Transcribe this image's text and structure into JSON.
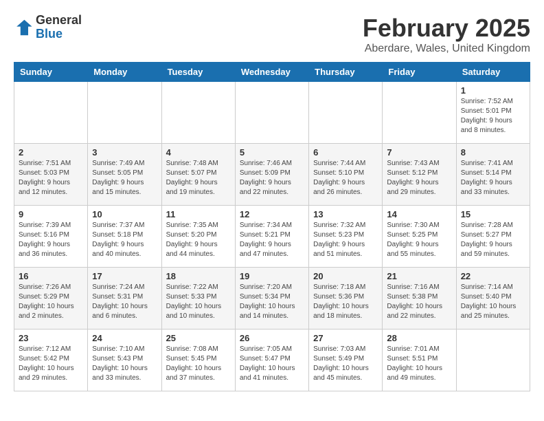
{
  "header": {
    "logo_general": "General",
    "logo_blue": "Blue",
    "title": "February 2025",
    "subtitle": "Aberdare, Wales, United Kingdom"
  },
  "columns": [
    "Sunday",
    "Monday",
    "Tuesday",
    "Wednesday",
    "Thursday",
    "Friday",
    "Saturday"
  ],
  "weeks": [
    [
      {
        "day": "",
        "info": ""
      },
      {
        "day": "",
        "info": ""
      },
      {
        "day": "",
        "info": ""
      },
      {
        "day": "",
        "info": ""
      },
      {
        "day": "",
        "info": ""
      },
      {
        "day": "",
        "info": ""
      },
      {
        "day": "1",
        "info": "Sunrise: 7:52 AM\nSunset: 5:01 PM\nDaylight: 9 hours and 8 minutes."
      }
    ],
    [
      {
        "day": "2",
        "info": "Sunrise: 7:51 AM\nSunset: 5:03 PM\nDaylight: 9 hours and 12 minutes."
      },
      {
        "day": "3",
        "info": "Sunrise: 7:49 AM\nSunset: 5:05 PM\nDaylight: 9 hours and 15 minutes."
      },
      {
        "day": "4",
        "info": "Sunrise: 7:48 AM\nSunset: 5:07 PM\nDaylight: 9 hours and 19 minutes."
      },
      {
        "day": "5",
        "info": "Sunrise: 7:46 AM\nSunset: 5:09 PM\nDaylight: 9 hours and 22 minutes."
      },
      {
        "day": "6",
        "info": "Sunrise: 7:44 AM\nSunset: 5:10 PM\nDaylight: 9 hours and 26 minutes."
      },
      {
        "day": "7",
        "info": "Sunrise: 7:43 AM\nSunset: 5:12 PM\nDaylight: 9 hours and 29 minutes."
      },
      {
        "day": "8",
        "info": "Sunrise: 7:41 AM\nSunset: 5:14 PM\nDaylight: 9 hours and 33 minutes."
      }
    ],
    [
      {
        "day": "9",
        "info": "Sunrise: 7:39 AM\nSunset: 5:16 PM\nDaylight: 9 hours and 36 minutes."
      },
      {
        "day": "10",
        "info": "Sunrise: 7:37 AM\nSunset: 5:18 PM\nDaylight: 9 hours and 40 minutes."
      },
      {
        "day": "11",
        "info": "Sunrise: 7:35 AM\nSunset: 5:20 PM\nDaylight: 9 hours and 44 minutes."
      },
      {
        "day": "12",
        "info": "Sunrise: 7:34 AM\nSunset: 5:21 PM\nDaylight: 9 hours and 47 minutes."
      },
      {
        "day": "13",
        "info": "Sunrise: 7:32 AM\nSunset: 5:23 PM\nDaylight: 9 hours and 51 minutes."
      },
      {
        "day": "14",
        "info": "Sunrise: 7:30 AM\nSunset: 5:25 PM\nDaylight: 9 hours and 55 minutes."
      },
      {
        "day": "15",
        "info": "Sunrise: 7:28 AM\nSunset: 5:27 PM\nDaylight: 9 hours and 59 minutes."
      }
    ],
    [
      {
        "day": "16",
        "info": "Sunrise: 7:26 AM\nSunset: 5:29 PM\nDaylight: 10 hours and 2 minutes."
      },
      {
        "day": "17",
        "info": "Sunrise: 7:24 AM\nSunset: 5:31 PM\nDaylight: 10 hours and 6 minutes."
      },
      {
        "day": "18",
        "info": "Sunrise: 7:22 AM\nSunset: 5:33 PM\nDaylight: 10 hours and 10 minutes."
      },
      {
        "day": "19",
        "info": "Sunrise: 7:20 AM\nSunset: 5:34 PM\nDaylight: 10 hours and 14 minutes."
      },
      {
        "day": "20",
        "info": "Sunrise: 7:18 AM\nSunset: 5:36 PM\nDaylight: 10 hours and 18 minutes."
      },
      {
        "day": "21",
        "info": "Sunrise: 7:16 AM\nSunset: 5:38 PM\nDaylight: 10 hours and 22 minutes."
      },
      {
        "day": "22",
        "info": "Sunrise: 7:14 AM\nSunset: 5:40 PM\nDaylight: 10 hours and 25 minutes."
      }
    ],
    [
      {
        "day": "23",
        "info": "Sunrise: 7:12 AM\nSunset: 5:42 PM\nDaylight: 10 hours and 29 minutes."
      },
      {
        "day": "24",
        "info": "Sunrise: 7:10 AM\nSunset: 5:43 PM\nDaylight: 10 hours and 33 minutes."
      },
      {
        "day": "25",
        "info": "Sunrise: 7:08 AM\nSunset: 5:45 PM\nDaylight: 10 hours and 37 minutes."
      },
      {
        "day": "26",
        "info": "Sunrise: 7:05 AM\nSunset: 5:47 PM\nDaylight: 10 hours and 41 minutes."
      },
      {
        "day": "27",
        "info": "Sunrise: 7:03 AM\nSunset: 5:49 PM\nDaylight: 10 hours and 45 minutes."
      },
      {
        "day": "28",
        "info": "Sunrise: 7:01 AM\nSunset: 5:51 PM\nDaylight: 10 hours and 49 minutes."
      },
      {
        "day": "",
        "info": ""
      }
    ]
  ]
}
